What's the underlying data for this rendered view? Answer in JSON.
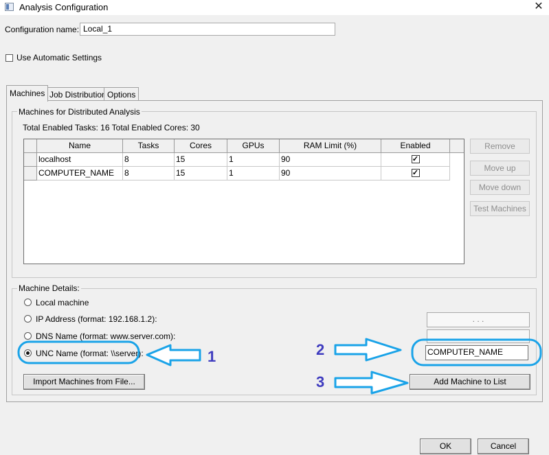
{
  "window": {
    "title": "Analysis Configuration",
    "close_glyph": "✕"
  },
  "config": {
    "label": "Configuration name:",
    "value": "Local_1"
  },
  "auto_settings": {
    "label": "Use Automatic Settings",
    "checked": false
  },
  "tabs": [
    {
      "label": "Machines",
      "active": true
    },
    {
      "label": "Job Distribution",
      "active": false
    },
    {
      "label": "Options",
      "active": false
    }
  ],
  "machines_group": {
    "title": "Machines for Distributed Analysis",
    "totals": "Total Enabled Tasks: 16  Total Enabled Cores: 30",
    "columns": [
      "Name",
      "Tasks",
      "Cores",
      "GPUs",
      "RAM Limit (%)",
      "Enabled"
    ],
    "rows": [
      {
        "name": "localhost",
        "tasks": "8",
        "cores": "15",
        "gpus": "1",
        "ram": "90",
        "enabled": true
      },
      {
        "name": "COMPUTER_NAME",
        "tasks": "8",
        "cores": "15",
        "gpus": "1",
        "ram": "90",
        "enabled": true
      }
    ],
    "check_glyph": "✓"
  },
  "side_buttons": {
    "remove": "Remove",
    "move_up": "Move up",
    "move_down": "Move down",
    "test": "Test Machines"
  },
  "details_group": {
    "title": "Machine Details:",
    "options": [
      {
        "label": "Local machine",
        "checked": false
      },
      {
        "label": "IP Address (format: 192.168.1.2):",
        "checked": false
      },
      {
        "label": "DNS Name (format: www.server.com):",
        "checked": false
      },
      {
        "label": "UNC Name (format: \\\\server):",
        "checked": true
      }
    ],
    "ip_value": ".       .       .",
    "dns_value": "",
    "unc_value": "COMPUTER_NAME",
    "import_button": "Import Machines from File...",
    "add_button": "Add Machine to List"
  },
  "annotations": {
    "num1": "1",
    "num2": "2",
    "num3": "3",
    "color": "#1aa3e8",
    "number_color": "#3f3cbf"
  },
  "footer": {
    "ok": "OK",
    "cancel": "Cancel"
  }
}
